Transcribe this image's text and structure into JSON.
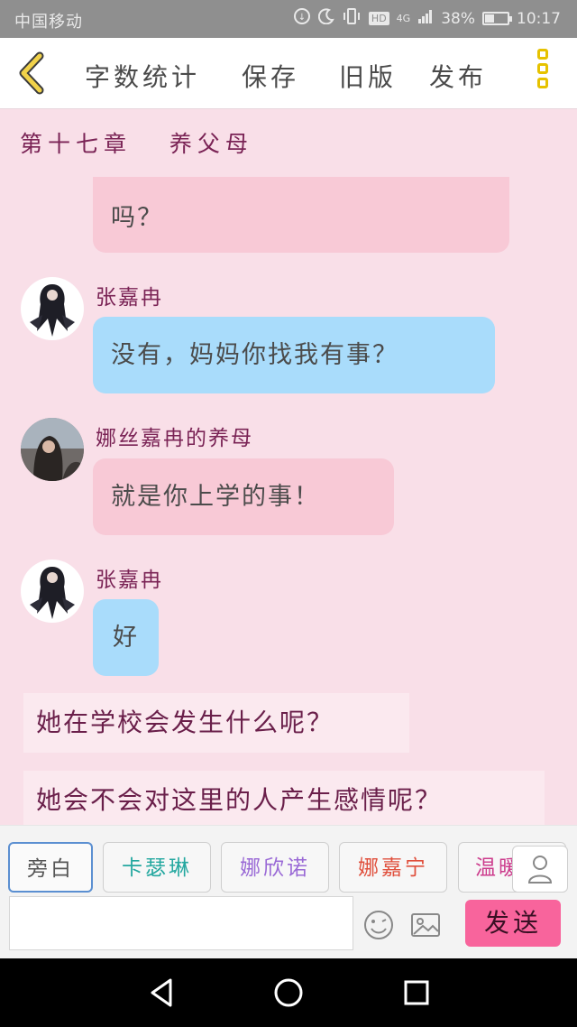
{
  "status_bar": {
    "carrier": "中国移动",
    "battery": "38%",
    "time": "10:17",
    "network": "4G",
    "hd": "HD"
  },
  "top_bar": {
    "word_count": "字数统计",
    "save": "保存",
    "old_version": "旧版",
    "publish": "发布"
  },
  "chapter": {
    "title": "第十七章",
    "subtitle": "养父母"
  },
  "messages": {
    "m0": {
      "text": "吗？"
    },
    "m1": {
      "name": "张嘉冉",
      "text": "没有，妈妈你找我有事？"
    },
    "m2": {
      "name": "娜丝嘉冉的养母",
      "text": "就是你上学的事！"
    },
    "m3": {
      "name": "张嘉冉",
      "text": "好"
    }
  },
  "narration": {
    "n1": "她在学校会发生什么呢？",
    "n2": "她会不会对这里的人产生感情呢？"
  },
  "roles": [
    {
      "label": "旁白",
      "color": "#555555"
    },
    {
      "label": "卡瑟琳",
      "color": "#25a8a0"
    },
    {
      "label": "娜欣诺",
      "color": "#9a6ad6"
    },
    {
      "label": "娜嘉宁",
      "color": "#e0503d"
    },
    {
      "label": "温暖",
      "color": "#cc3b8c"
    }
  ],
  "composer": {
    "input_value": "",
    "send": "发送"
  },
  "icons": {
    "back": "chevron-left-icon",
    "menu": "more-vertical-icon",
    "emoji": "emoji-icon",
    "image": "image-icon",
    "person": "person-icon",
    "nav_back": "triangle-back-icon",
    "nav_home": "circle-home-icon",
    "nav_recent": "square-recent-icon"
  }
}
